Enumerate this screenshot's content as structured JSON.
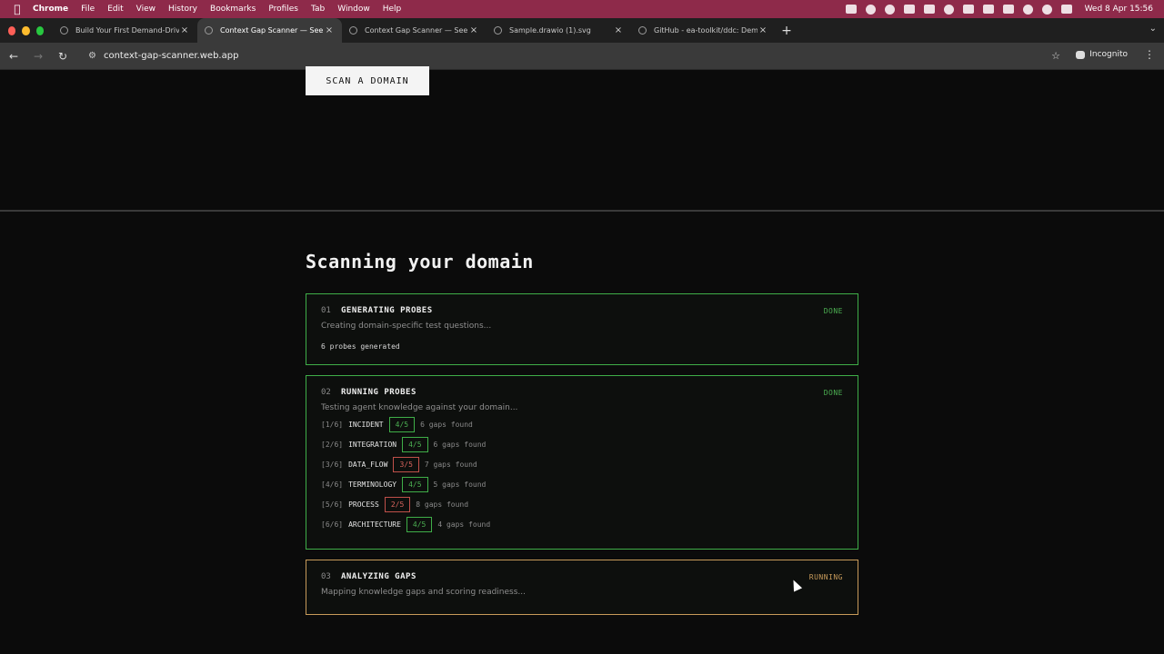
{
  "menubar": {
    "app": "Chrome",
    "items": [
      "File",
      "Edit",
      "View",
      "History",
      "Bookmarks",
      "Profiles",
      "Tab",
      "Window",
      "Help"
    ],
    "clock": "Wed 8 Apr  15:56"
  },
  "tabs": [
    {
      "title": "Build Your First Demand-Driv"
    },
    {
      "title": "Context Gap Scanner — See v"
    },
    {
      "title": "Context Gap Scanner — See v"
    },
    {
      "title": "Sample.drawio (1).svg"
    },
    {
      "title": "GitHub - ea-toolkit/ddc: Dem"
    }
  ],
  "toolbar": {
    "url": "context-gap-scanner.web.app",
    "incognito_label": "Incognito"
  },
  "page": {
    "scan_button": "SCAN A DOMAIN",
    "heading": "Scanning your domain",
    "steps": [
      {
        "num": "01",
        "title": "GENERATING PROBES",
        "status": "DONE",
        "desc": "Creating domain-specific test questions...",
        "note": "6 probes generated"
      },
      {
        "num": "02",
        "title": "RUNNING PROBES",
        "status": "DONE",
        "desc": "Testing agent knowledge against your domain...",
        "probes": [
          {
            "idx": "[1/6]",
            "cat": "INCIDENT",
            "score": "4/5",
            "gaps": "6 gaps found"
          },
          {
            "idx": "[2/6]",
            "cat": "INTEGRATION",
            "score": "4/5",
            "gaps": "6 gaps found"
          },
          {
            "idx": "[3/6]",
            "cat": "DATA_FLOW",
            "score": "3/5",
            "gaps": "7 gaps found"
          },
          {
            "idx": "[4/6]",
            "cat": "TERMINOLOGY",
            "score": "4/5",
            "gaps": "5 gaps found"
          },
          {
            "idx": "[5/6]",
            "cat": "PROCESS",
            "score": "2/5",
            "gaps": "8 gaps found"
          },
          {
            "idx": "[6/6]",
            "cat": "ARCHITECTURE",
            "score": "4/5",
            "gaps": "4 gaps found"
          }
        ]
      },
      {
        "num": "03",
        "title": "ANALYZING GAPS",
        "status": "RUNNING",
        "desc": "Mapping knowledge gaps and scoring readiness..."
      }
    ]
  },
  "colors": {
    "done": "#4cb052",
    "running": "#c79a5a",
    "low_score": "#d9655e",
    "background": "#0b0b0b"
  }
}
